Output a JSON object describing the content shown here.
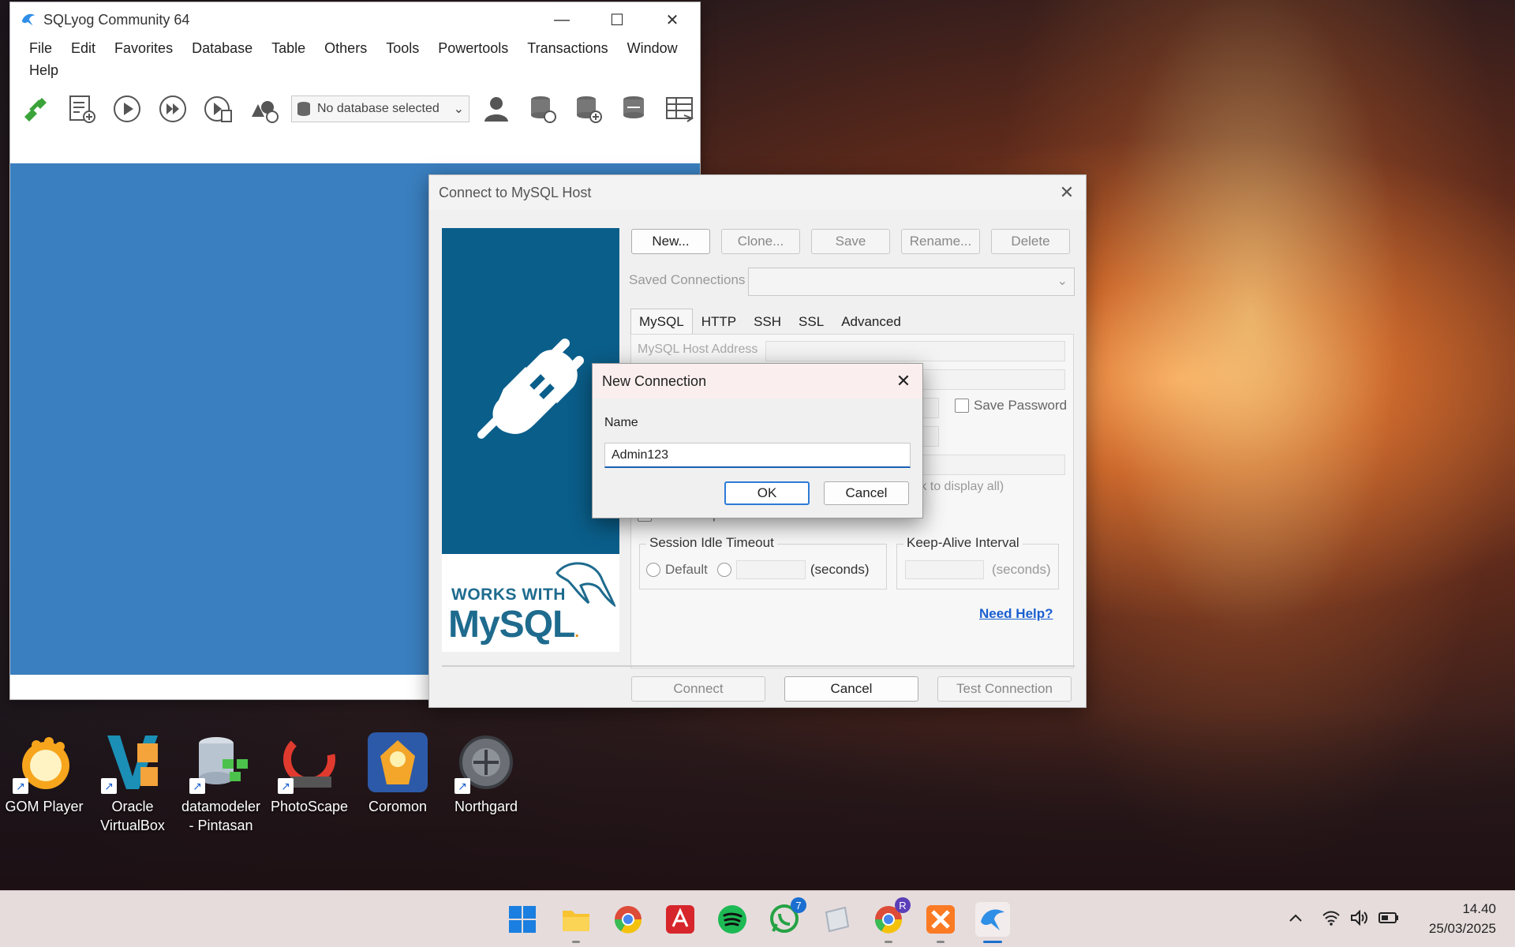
{
  "main_window": {
    "title": "SQLyog Community 64",
    "menu": [
      "File",
      "Edit",
      "Favorites",
      "Database",
      "Table",
      "Others",
      "Tools",
      "Powertools",
      "Transactions",
      "Window",
      "Help"
    ],
    "db_selector": "No database selected"
  },
  "connect_dialog": {
    "title": "Connect to MySQL Host",
    "buttons": {
      "new": "New...",
      "clone": "Clone...",
      "save": "Save",
      "rename": "Rename...",
      "delete": "Delete"
    },
    "saved_connections_label": "Saved Connections",
    "tabs": [
      "MySQL",
      "HTTP",
      "SSH",
      "SSL",
      "Advanced"
    ],
    "host_label": "MySQL Host Address",
    "save_password": "Save Password",
    "db_hint": "(Use ';' to separate multiple databases. Leave blank to display all)",
    "compressed": "Use Compressed Protocol",
    "session_idle": {
      "legend": "Session Idle Timeout",
      "default": "Default",
      "seconds": "(seconds)"
    },
    "keep_alive": {
      "legend": "Keep-Alive Interval",
      "seconds": "(seconds)"
    },
    "help": "Need Help?",
    "banner": {
      "works_with": "WORKS WITH",
      "mysql_my": "MySQL",
      "mysql_dot": "."
    },
    "footer": {
      "connect": "Connect",
      "cancel": "Cancel",
      "test": "Test Connection"
    }
  },
  "new_connection": {
    "title": "New Connection",
    "name_label": "Name",
    "name_value": "Admin123",
    "ok": "OK",
    "cancel": "Cancel"
  },
  "desktop_icons": [
    {
      "label1": "GOM Player",
      "label2": "",
      "icon": "gom-player-icon"
    },
    {
      "label1": "Oracle",
      "label2": "VirtualBox",
      "icon": "virtualbox-icon"
    },
    {
      "label1": "datamodeler",
      "label2": "- Pintasan",
      "icon": "datamodeler-icon"
    },
    {
      "label1": "PhotoScape",
      "label2": "",
      "icon": "photoscape-icon"
    },
    {
      "label1": "Coromon",
      "label2": "",
      "icon": "coromon-icon"
    },
    {
      "label1": "Northgard",
      "label2": "",
      "icon": "northgard-icon"
    }
  ],
  "taskbar": {
    "whatsapp_badge": "7",
    "chrome_profile_badge": "R",
    "time": "14.40",
    "date": "25/03/2025"
  },
  "colors": {
    "client_area": "#3a7fbf",
    "banner": "#0a5e8a",
    "accent": "#1a6fd0"
  }
}
